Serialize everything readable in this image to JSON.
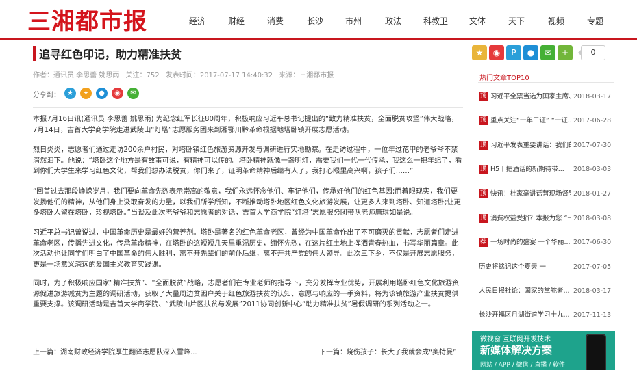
{
  "header": {
    "logo": "三湘都市报",
    "nav": [
      "经济",
      "财经",
      "消费",
      "长沙",
      "市州",
      "政法",
      "科教卫",
      "文体",
      "天下",
      "视频",
      "专题"
    ]
  },
  "article": {
    "title": "追寻红色印记，助力精准扶贫",
    "meta": {
      "author": "作者：通讯员 李思蕾 姚思雨",
      "views": "关注：752",
      "published": "发表时间：2017-07-17 14:40:32",
      "source": "来源：三湘都市报"
    },
    "share_label": "分享到：",
    "paragraphs": [
      "本报7月16日讯(通讯员 李思蕾 姚思雨) 为纪念红军长征80周年，积极响应习近平总书记提出的“致力精准扶贫，全面脱贫攻坚”伟大战略， 7月14日，吉首大学商学院走进武陵山“灯塔”志愿服务团来到湘鄂川黔革命根据地塔卧镇开展志愿活动。",
      "烈日炎炎，志愿者们通过走访200余户村民，对塔卧镇红色旅游资源开发与调研进行实地勘察。在走访过程中，一位年过花甲的老爷爷不禁潸然泪下。他说：“塔卧这个地方是有故事可说，有精神可以传的。塔卧精神就像一盏明灯，需要我们一代一代传承，我这么一把年纪了，看到你们大学生来学习红色文化，帮我们想办法脱贫，你们来了，证明革命精神后继有人了，我打心眼里高兴啊，孩子们……”",
      "“回首过去那段峥嵘岁月，我们要向革命先烈表示崇高的敬意，我们永远怀念他们、牢记他们，传承好他们的红色基因;而着眼现实，我们要发扬他们的精神，从他们身上汲取奋发的力量，以我们所学所知，不断推动塔卧地区红色文化旅游发展，让更多人来到塔卧、知道塔卧;让更多塔卧人留在塔卧，珍视塔卧。”当谈及此次老爷爷和志愿者的对话，吉首大学商学院“灯塔”志愿服务团带队老师唐琪如是说。",
      "习近平总书记曾说过，中国革命历史是最好的营养剂。塔卧是著名的红色革命老区，曾经为中国革命作出了不可磨灭的贡献，志愿者们走进革命老区，传播先进文化，传承革命精神，在塔卧的这短短几天里重温历史，缅怀先烈，在这片红土地上挥洒青春热血，书写华丽篇章。此次活动也让同学们明白了中国革命的伟大胜利，离不开先辈们的前仆后继，离不开共产党的伟大领导。此次三下乡，不仅是开展志愿服务，更是一场意义深远的爱国主义教育实践课。",
      "同时，为了积极响应国家“精准扶贫”、“全面脱贫”战略，志愿者们在专业老师的指导下，充分发挥专业优势，开展利用塔卧红色文化旅游资源促进旅游减贫为主题的调研活动，获取了大量周边贫困户关于红色旅游扶贫的认知、意愿与响应的一手资料，将为该镇旅游产业扶贫提供重要支撑。该调研活动是吉首大学商学院、“武陵山片区扶贫与发展”2011协同创新中心“助力精准扶贫”暑假调研的系列活动之一。"
    ],
    "prev": "上一篇：湖南财政经济学院厚生翻译志愿队深入雪峰...",
    "next": "下一篇：烧伤孩子：长大了我就会成“奥特曼”"
  },
  "sidebar": {
    "share_count": "0",
    "top10_title": "热门文章TOP10",
    "hot": [
      {
        "tag": "顶",
        "text": "习近平全票当选为国家主席、...",
        "date": "2018-03-17"
      },
      {
        "tag": "顶",
        "text": "重点关注“一年三证” “一证...",
        "date": "2017-06-28"
      },
      {
        "tag": "顶",
        "text": "习近平发表重要讲话：我们的...",
        "date": "2017-07-30"
      },
      {
        "tag": "顶",
        "text": "H5丨把酒话的新期待带...",
        "date": "2018-03-03"
      },
      {
        "tag": "顶",
        "text": "快讯！杜家毫讲话暂现场督导...",
        "date": "2018-01-27"
      },
      {
        "tag": "顶",
        "text": "消费权益受损？本报为您 “一...",
        "date": "2018-03-08"
      },
      {
        "tag": "荐",
        "text": "一场时尚的盛宴 一个华丽...",
        "date": "2017-06-30"
      },
      {
        "tag": "",
        "text": "历史将铭记这个夏天 一...",
        "date": "2017-07-05"
      },
      {
        "tag": "",
        "text": "人民日报社论：国家的掌舵者...",
        "date": "2018-03-17"
      },
      {
        "tag": "",
        "text": "长沙开福区月湖街道学习十九...",
        "date": "2017-11-13"
      }
    ],
    "ad": {
      "top": "微视窗   互联网开发技术",
      "big": "新媒体解决方案",
      "sub": "网站 / APP / 微信 / 直播 / 软件"
    }
  },
  "colors": {
    "brand_red": "#c8161e",
    "ad_green": "#1ea38c"
  }
}
